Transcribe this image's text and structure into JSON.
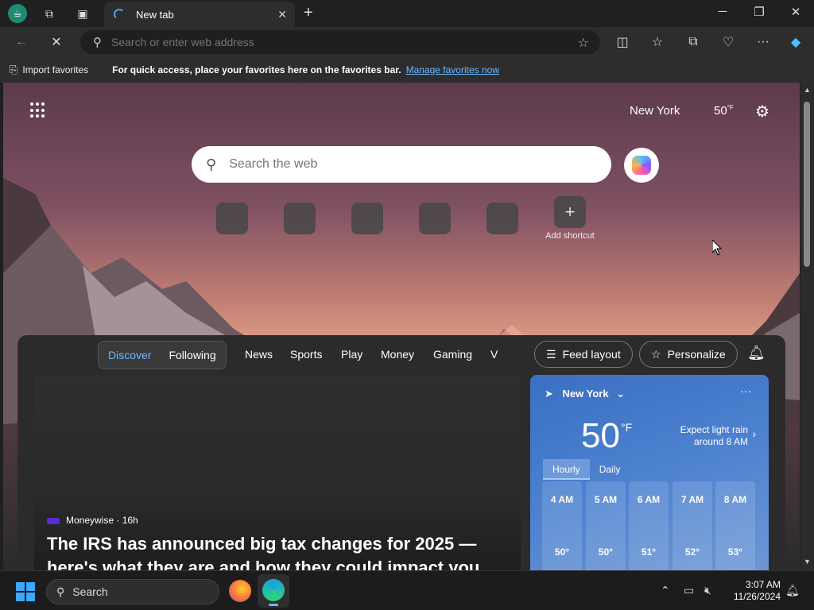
{
  "tab": {
    "title": "New tab"
  },
  "addressbar": {
    "placeholder": "Search or enter web address"
  },
  "favbar": {
    "import_label": "Import favorites",
    "message": "For quick access, place your favorites here on the favorites bar.",
    "link": "Manage favorites now"
  },
  "ntp": {
    "city": "New York",
    "temp": "50",
    "unit": "°F",
    "search_placeholder": "Search the web",
    "add_shortcut": "Add shortcut"
  },
  "feed": {
    "pills": [
      "Discover",
      "Following"
    ],
    "nav": [
      "News",
      "Sports",
      "Play",
      "Money",
      "Gaming",
      "V"
    ],
    "feed_layout": "Feed layout",
    "personalize": "Personalize",
    "article": {
      "source": "Moneywise · 16h",
      "headline": "The IRS has announced big tax changes for 2025 — here's what they are and how they could impact you"
    }
  },
  "weather": {
    "location": "New York",
    "temp": "50",
    "unit": "°F",
    "forecast_line1": "Expect light rain",
    "forecast_line2": "around 8 AM",
    "tabs": [
      "Hourly",
      "Daily"
    ],
    "hours": [
      {
        "time": "4 AM",
        "temp": "50°"
      },
      {
        "time": "5 AM",
        "temp": "50°"
      },
      {
        "time": "6 AM",
        "temp": "51°"
      },
      {
        "time": "7 AM",
        "temp": "52°"
      },
      {
        "time": "8 AM",
        "temp": "53°"
      }
    ]
  },
  "taskbar": {
    "search": "Search",
    "time": "3:07 AM",
    "date": "11/26/2024"
  },
  "colors": {
    "accent": "#6cb8ff",
    "weather": "#4d82d0"
  }
}
